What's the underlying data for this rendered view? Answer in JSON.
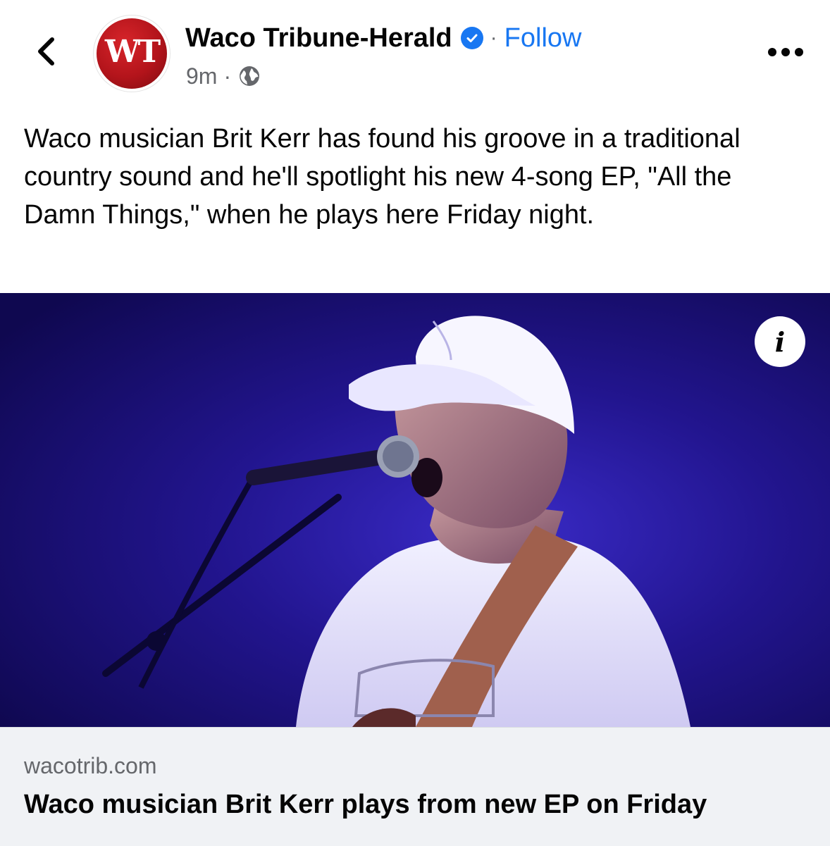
{
  "header": {
    "back_icon": "chevron-left-icon",
    "avatar_text": "WT",
    "page_name": "Waco Tribune-Herald",
    "verified_icon": "verified-badge-icon",
    "separator": "·",
    "follow_label": "Follow",
    "time": "9m",
    "meta_separator": "·",
    "audience_icon": "globe-icon",
    "more_icon": "more-horizontal-icon"
  },
  "post": {
    "caption": "Waco musician Brit Kerr has found his groove in a traditional country sound and he'll spotlight his new 4-song EP, \"All the Damn Things,\" when he plays here Friday night."
  },
  "media": {
    "info_label": "i"
  },
  "link_preview": {
    "domain": "wacotrib.com",
    "title": "Waco musician Brit Kerr plays from new EP on Friday"
  },
  "colors": {
    "accent": "#1877f2",
    "secondary_text": "#65676b",
    "card_background": "#f0f2f5",
    "photo_background": "#1a0f72"
  }
}
